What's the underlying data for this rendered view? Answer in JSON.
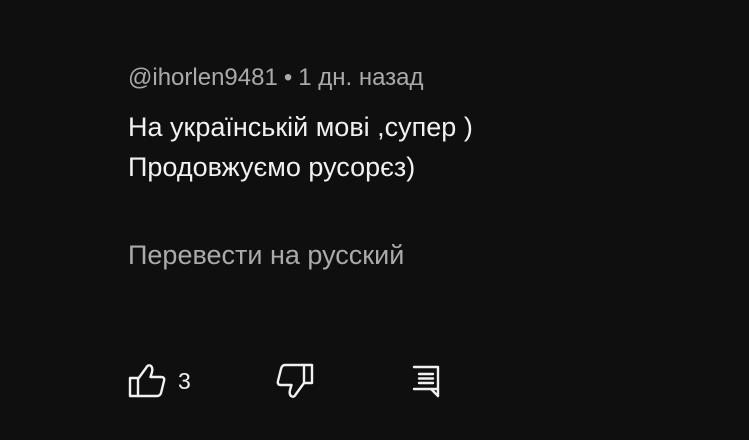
{
  "comment": {
    "author": "@ihorlen9481",
    "separator": "•",
    "time": "1 дн. назад",
    "text_lines": [
      "На українській мові ,супер )",
      "Продовжуємо русорєз)"
    ],
    "translate_label": "Перевести на русский"
  },
  "actions": {
    "like_icon": "thumbs-up-icon",
    "like_count": "3",
    "dislike_icon": "thumbs-down-icon",
    "reply_icon": "reply-comment-icon"
  },
  "colors": {
    "background": "#0f0f0f",
    "primary_text": "#f1f1f1",
    "secondary_text": "#aaaaaa"
  }
}
